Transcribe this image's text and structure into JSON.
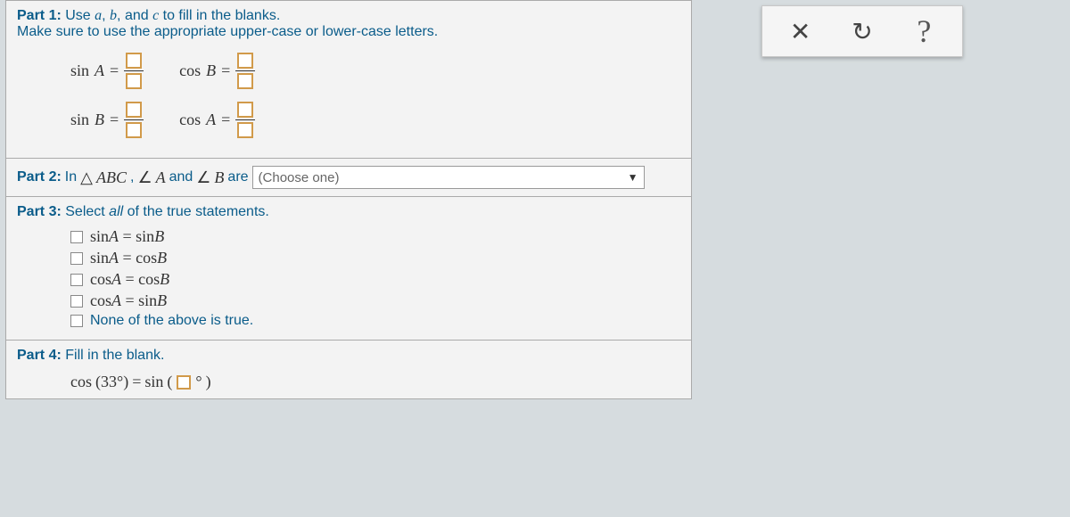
{
  "part1": {
    "label": "Part 1:",
    "instr_line1": " Use ",
    "var_a": "a",
    "comma1": ", ",
    "var_b": "b",
    "comma2": ", and ",
    "var_c": "c",
    "instr_line1_end": " to fill in the blanks.",
    "instr_line2": "Make sure to use the appropriate upper-case or lower-case letters.",
    "eq1_lhs": "sin",
    "eq1_var": "A",
    "eq1_eq": " = ",
    "eq2_lhs": "cos",
    "eq2_var": "B",
    "eq2_eq": " = ",
    "eq3_lhs": "sin",
    "eq3_var": "B",
    "eq3_eq": " = ",
    "eq4_lhs": "cos",
    "eq4_var": "A",
    "eq4_eq": " = "
  },
  "part2": {
    "label": "Part 2:",
    "text_in": " In ",
    "triangle": "△",
    "tri_name": "ABC",
    "comma": ", ",
    "angle1": "∠",
    "a1var": "A",
    "and": " and ",
    "angle2": "∠",
    "a2var": "B",
    "are": " are ",
    "dropdown_placeholder": "(Choose one)"
  },
  "part3": {
    "label": "Part 3:",
    "instr_pre": " Select ",
    "instr_em": "all",
    "instr_post": " of the true statements.",
    "options": [
      {
        "lhs": "sin",
        "lv": "A",
        "eq": " = ",
        "rhs": "sin",
        "rv": "B"
      },
      {
        "lhs": "sin",
        "lv": "A",
        "eq": " = ",
        "rhs": "cos",
        "rv": "B"
      },
      {
        "lhs": "cos",
        "lv": "A",
        "eq": " = ",
        "rhs": "cos",
        "rv": "B"
      },
      {
        "lhs": "cos",
        "lv": "A",
        "eq": " = ",
        "rhs": "sin",
        "rv": "B"
      }
    ],
    "none_text": "None of the above is true."
  },
  "part4": {
    "label": "Part 4:",
    "instr": " Fill in the blank.",
    "lhs_fn": "cos",
    "lhs_arg": "(33°)",
    "eq": " = ",
    "rhs_fn": "sin",
    "rhs_open": "(",
    "rhs_deg": "°",
    "rhs_close": ")"
  },
  "toolbar": {
    "close": "✕",
    "reset": "↻",
    "help": "?"
  }
}
